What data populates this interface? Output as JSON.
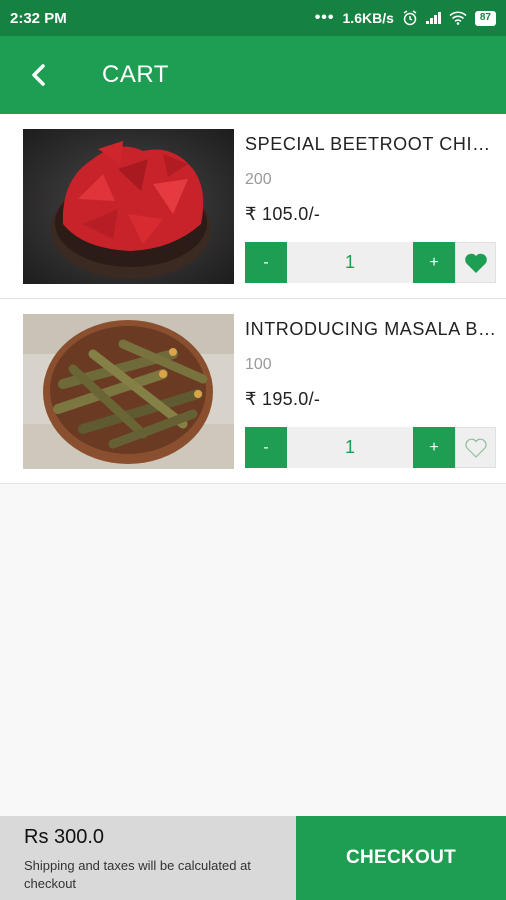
{
  "status_bar": {
    "time": "2:32 PM",
    "dots": "•••",
    "network_speed": "1.6KB/s",
    "alarm_icon": "alarm-icon",
    "signal_icon": "signal-icon",
    "wifi_icon": "wifi-icon",
    "battery": "87"
  },
  "app_bar": {
    "title": "CART",
    "back_icon": "back-arrow-icon",
    "color": "#1e9e52"
  },
  "items": [
    {
      "name": "SPECIAL BEETROOT CHIPS",
      "weight": "200",
      "price": "₹ 105.0/-",
      "quantity": "1",
      "decrement": "-",
      "increment": "+",
      "favorite": true,
      "image": "beetroot-chips-image"
    },
    {
      "name": "INTRODUCING MASALA BHINDI",
      "weight": "100",
      "price": "₹ 195.0/-",
      "quantity": "1",
      "decrement": "-",
      "increment": "+",
      "favorite": false,
      "image": "okra-bowl-image"
    }
  ],
  "footer": {
    "total": "Rs 300.0",
    "shipping_note": "Shipping and taxes will be calculated at checkout",
    "checkout_label": "CHECKOUT"
  },
  "colors": {
    "primary": "#1e9e52",
    "status_bar": "#168241",
    "footer_bg": "#d9d9d9"
  }
}
